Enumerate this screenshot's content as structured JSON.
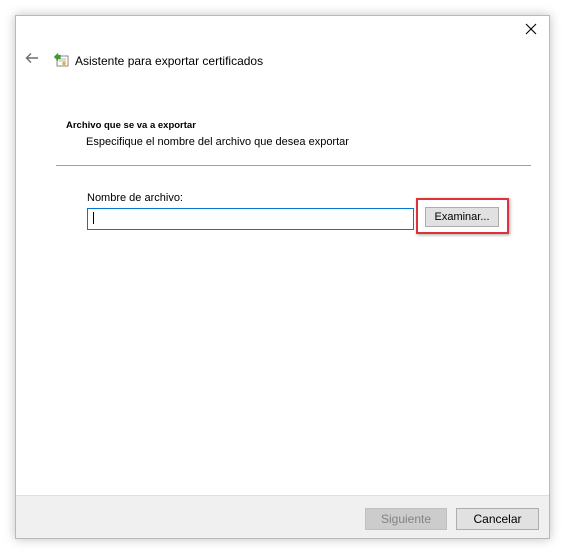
{
  "window": {
    "title": "Asistente para exportar certificados",
    "close_glyph": "✕",
    "back_glyph": "←"
  },
  "section": {
    "heading": "Archivo que se va a exportar",
    "description": "Especifique el nombre del archivo que desea exportar"
  },
  "form": {
    "filename_label": "Nombre de archivo:",
    "filename_value": "",
    "filename_placeholder": "",
    "browse_label": "Examinar..."
  },
  "footer": {
    "next_label": "Siguiente",
    "cancel_label": "Cancelar"
  },
  "colors": {
    "focus_border": "#0078d7",
    "highlight_border": "#e0303b",
    "footer_bg": "#f0f0f0",
    "disabled_text": "#838383"
  },
  "icons": {
    "back": "arrow-left-icon",
    "app": "certificate-export-icon",
    "close": "close-icon"
  }
}
